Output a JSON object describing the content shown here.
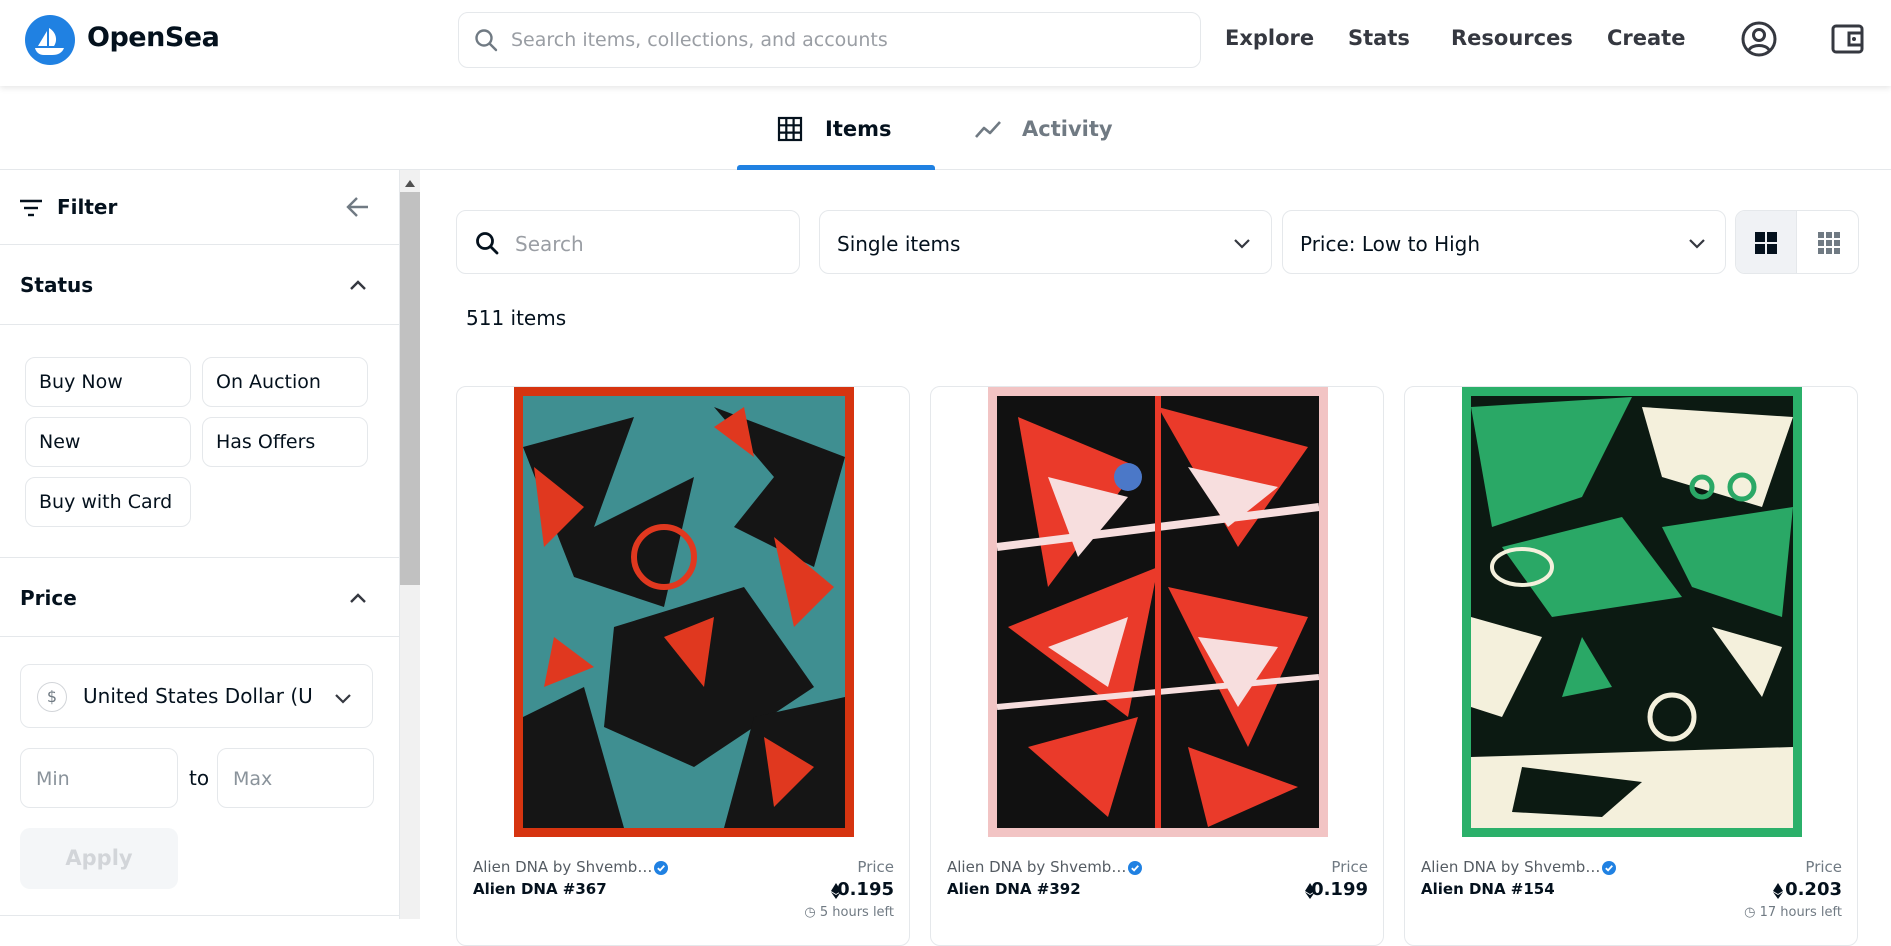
{
  "brand": {
    "name": "OpenSea",
    "accent": "#2081e2"
  },
  "search": {
    "placeholder": "Search items, collections, and accounts"
  },
  "nav": {
    "explore": "Explore",
    "stats": "Stats",
    "resources": "Resources",
    "create": "Create"
  },
  "tabs": [
    {
      "label": "Items",
      "icon": "grid-icon"
    },
    {
      "label": "Activity",
      "icon": "activity-chart-icon"
    }
  ],
  "sidebar": {
    "filter_title": "Filter",
    "status": {
      "title": "Status",
      "options": [
        "Buy Now",
        "On Auction",
        "New",
        "Has Offers",
        "Buy with Card"
      ]
    },
    "price": {
      "title": "Price",
      "currency": "United States Dollar (USD)",
      "currency_symbol": "$",
      "min_placeholder": "Min",
      "to_label": "to",
      "max_placeholder": "Max",
      "apply_label": "Apply"
    }
  },
  "toolbar": {
    "search_placeholder": "Search",
    "items_filter": "Single items",
    "sort": "Price: Low to High"
  },
  "item_count": "511 items",
  "cards": [
    {
      "collection": "Alien DNA by Shvemb…",
      "name": "Alien DNA #367",
      "price_label": "Price",
      "price": "0.195",
      "time_left": "5 hours left",
      "frame_color": "#d63410",
      "art_colors": [
        "#3f8f91",
        "#151515",
        "#e0381f"
      ]
    },
    {
      "collection": "Alien DNA by Shvemb…",
      "name": "Alien DNA #392",
      "price_label": "Price",
      "price": "0.199",
      "time_left": "",
      "frame_color": "#f2c4c4",
      "art_colors": [
        "#ea3a2a",
        "#111111",
        "#f7dede"
      ]
    },
    {
      "collection": "Alien DNA by Shvemb…",
      "name": "Alien DNA #154",
      "price_label": "Price",
      "price": "0.203",
      "time_left": "17 hours left",
      "frame_color": "#2bb06a",
      "art_colors": [
        "#2aa866",
        "#0c1a12",
        "#f4f0dc"
      ]
    }
  ]
}
